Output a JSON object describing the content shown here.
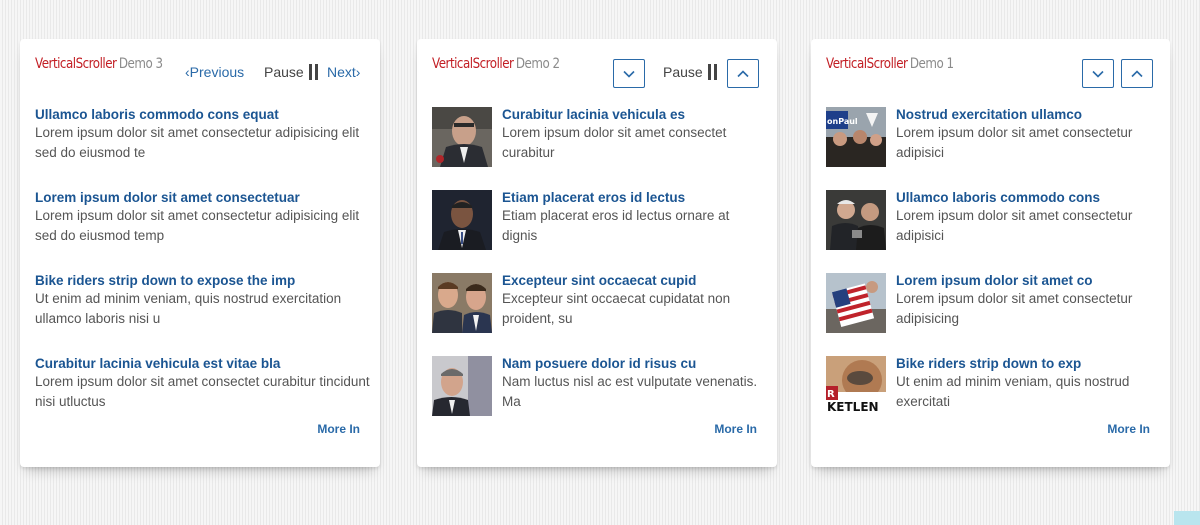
{
  "colors": {
    "brand": "#c21e24",
    "link": "#2a6aa8",
    "title": "#1b5592"
  },
  "demo3": {
    "brand": "VerticalScroller",
    "demo": "Demo 3",
    "previous_label": "Previous",
    "pause_label": "Pause",
    "next_label": "Next",
    "more_label": "More In",
    "items": [
      {
        "title": "Ullamco laboris commodo cons equat",
        "desc": "Lorem ipsum dolor sit amet consectetur adipisicing elit sed do eiusmod te"
      },
      {
        "title": "Lorem ipsum dolor sit amet consectetuar",
        "desc": "Lorem ipsum dolor sit amet consectetur adipisicing elit sed do eiusmod temp"
      },
      {
        "title": "Bike riders strip down to expose the imp",
        "desc": "Ut enim ad minim veniam, quis nostrud exercitation ullamco laboris nisi u"
      },
      {
        "title": "Curabitur lacinia vehicula est vitae bla",
        "desc": "Lorem ipsum dolor sit amet consectet curabitur tincidunt nisi utluctus"
      }
    ]
  },
  "demo2": {
    "brand": "VerticalScroller",
    "demo": "Demo 2",
    "pause_label": "Pause",
    "more_label": "More In",
    "down_icon": "chevron-down-icon",
    "up_icon": "chevron-up-icon",
    "items": [
      {
        "title": "Curabitur lacinia vehicula es",
        "desc": "Lorem ipsum dolor sit amet consectet curabitur"
      },
      {
        "title": "Etiam placerat eros id lectus",
        "desc": "Etiam placerat eros id lectus ornare at dignis"
      },
      {
        "title": "Excepteur sint occaecat cupid",
        "desc": "Excepteur sint occaecat cupidatat non proident, su"
      },
      {
        "title": "Nam posuere dolor id risus cu",
        "desc": "Nam luctus nisl ac est vulputate venenatis. Ma"
      }
    ]
  },
  "demo1": {
    "brand": "VerticalScroller",
    "demo": "Demo 1",
    "more_label": "More In",
    "down_icon": "chevron-down-icon",
    "up_icon": "chevron-up-icon",
    "items": [
      {
        "title": "Nostrud exercitation ullamco",
        "desc": "Lorem ipsum dolor sit amet consectetur adipisici",
        "thumb_text": "onPaul"
      },
      {
        "title": "Ullamco laboris commodo cons",
        "desc": "Lorem ipsum dolor sit amet consectetur adipisici"
      },
      {
        "title": "Lorem ipsum dolor sit amet co",
        "desc": "Lorem ipsum dolor sit amet consectetur adipisicing"
      },
      {
        "title": "Bike riders strip down to exp",
        "desc": "Ut enim ad minim veniam, quis nostrud exercitati",
        "thumb_text": "KETLEN",
        "thumb_text2": "R"
      }
    ]
  }
}
